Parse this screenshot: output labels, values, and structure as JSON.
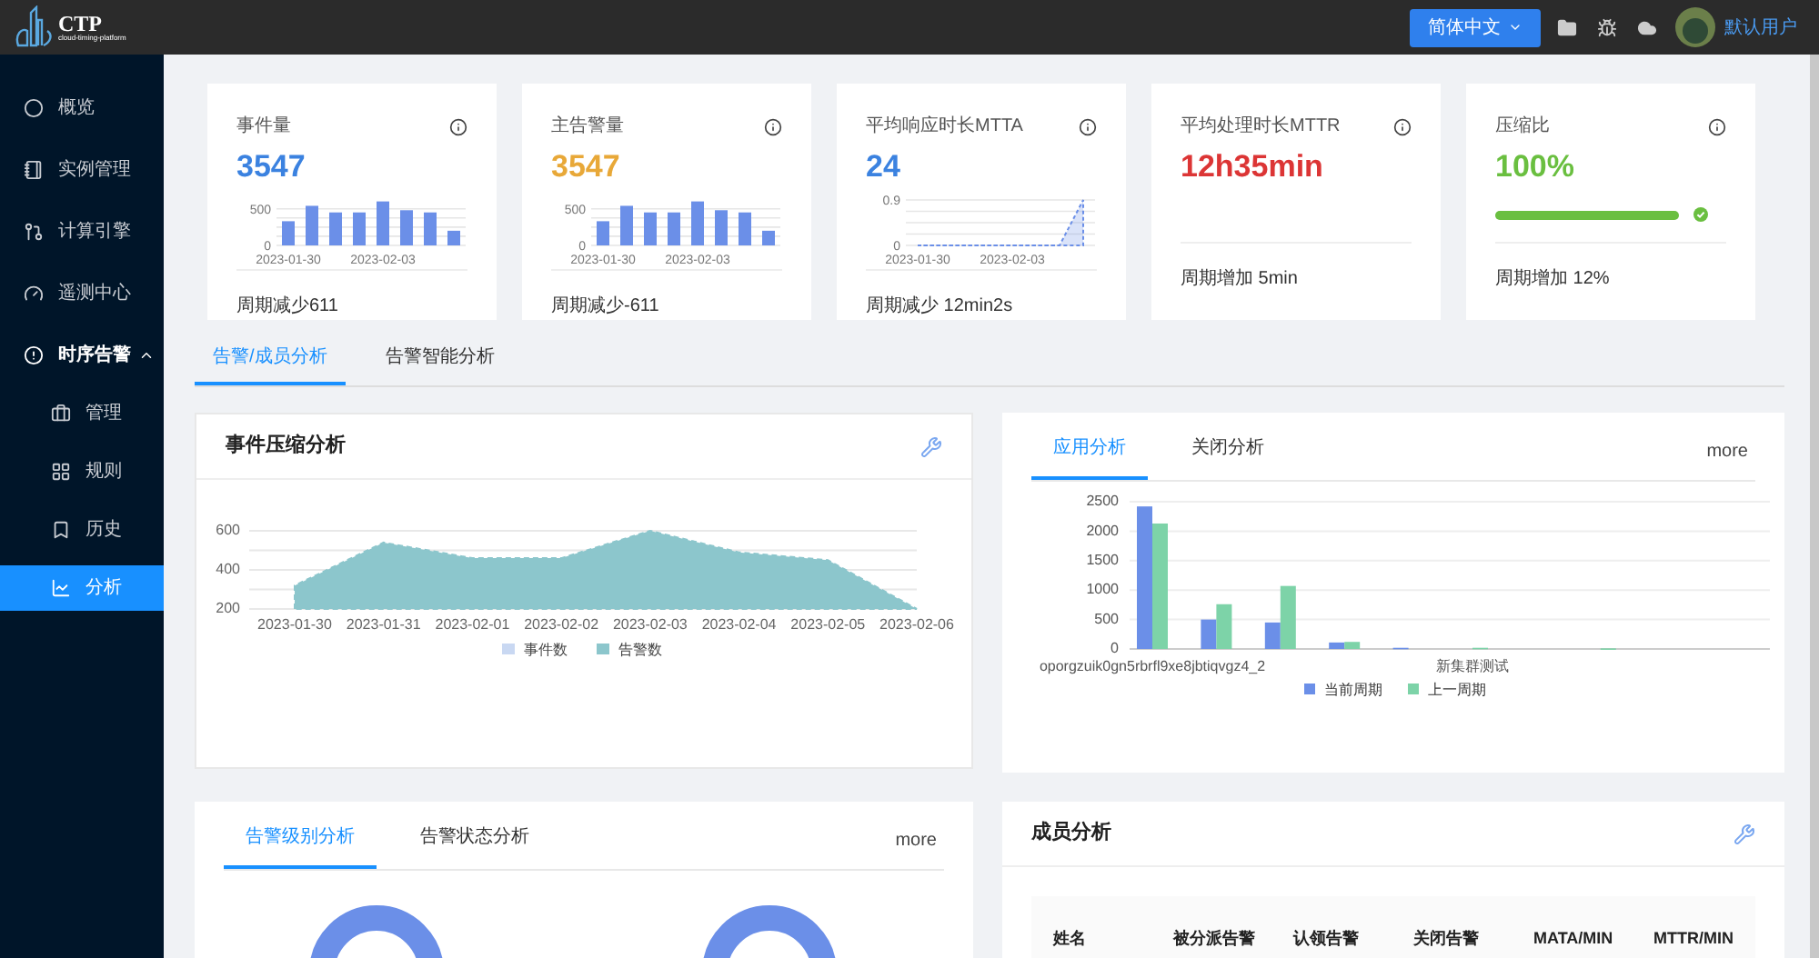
{
  "header": {
    "logo_title": "CTP",
    "logo_subtitle": "cloud-timing-platform",
    "language": "简体中文",
    "user": "默认用户"
  },
  "sidebar": {
    "items": [
      {
        "label": "概览",
        "selected": false
      },
      {
        "label": "实例管理",
        "selected": false
      },
      {
        "label": "计算引擎",
        "selected": false
      },
      {
        "label": "遥测中心",
        "selected": false
      },
      {
        "label": "时序告警",
        "selected": false,
        "expanded": true,
        "children": [
          {
            "label": "管理",
            "selected": false
          },
          {
            "label": "规则",
            "selected": false
          },
          {
            "label": "历史",
            "selected": false
          },
          {
            "label": "分析",
            "selected": true
          }
        ]
      }
    ]
  },
  "stat_cards": [
    {
      "kind": "bar",
      "title": "事件量",
      "value": "3547",
      "color": "#3b82e0",
      "footer": "周期减少611",
      "chart_data": {
        "type": "bar",
        "categories": [
          "2023-01-30",
          null,
          null,
          null,
          "2023-02-03",
          null,
          null,
          null
        ],
        "yticks": [
          0,
          500
        ],
        "ylim": [
          0,
          620
        ],
        "grid": true,
        "series": [
          {
            "color": "#6b8fe8",
            "values": [
              330,
              540,
              450,
              450,
              600,
              480,
              450,
              200
            ]
          }
        ]
      }
    },
    {
      "kind": "bar",
      "title": "主告警量",
      "value": "3547",
      "color": "#e8a838",
      "footer": "周期减少-611",
      "chart_data": {
        "type": "bar",
        "categories": [
          "2023-01-30",
          null,
          null,
          null,
          "2023-02-03",
          null,
          null,
          null
        ],
        "yticks": [
          0,
          500
        ],
        "ylim": [
          0,
          620
        ],
        "grid": true,
        "series": [
          {
            "color": "#6b8fe8",
            "values": [
              330,
              540,
              450,
              450,
              600,
              480,
              450,
              200
            ]
          }
        ]
      }
    },
    {
      "kind": "line",
      "title": "平均响应时长MTTA",
      "value": "24",
      "color": "#3b82e0",
      "footer": "周期减少 12min2s",
      "chart_data": {
        "type": "area",
        "categories": [
          "2023-01-30",
          null,
          null,
          null,
          "2023-02-03",
          null,
          null,
          null
        ],
        "yticks": [
          0,
          0.9
        ],
        "ylim": [
          0,
          0.9
        ],
        "grid": true,
        "series": [
          {
            "color": "#6b8fe8",
            "values": [
              0,
              0,
              0,
              0,
              0,
              0,
              0,
              0.9
            ]
          }
        ]
      }
    },
    {
      "kind": "none",
      "title": "平均处理时长MTTR",
      "value": "12h35min",
      "color": "#dc3535",
      "footer": "周期增加 5min"
    },
    {
      "kind": "progress",
      "title": "压缩比",
      "value": "100%",
      "color": "#6abf40",
      "level": 1,
      "footer": "周期增加 12%"
    }
  ],
  "tabs": [
    {
      "label": "告警/成员分析",
      "selected": true
    },
    {
      "label": "告警智能分析",
      "selected": false
    }
  ],
  "compression_panel": {
    "title": "事件压缩分析",
    "chart_data": {
      "type": "area",
      "categories": [
        "2023-01-30",
        "2023-01-31",
        "2023-02-01",
        "2023-02-02",
        "2023-02-03",
        "2023-02-04",
        "2023-02-05",
        "2023-02-06"
      ],
      "yticks": [
        200,
        400,
        600
      ],
      "ylim": [
        200,
        600
      ],
      "grid": true,
      "legend": "bottom",
      "series": [
        {
          "name": "事件数",
          "color": "#c9d8f2",
          "values": [
            null,
            null,
            null,
            null,
            null,
            null,
            null,
            null
          ]
        },
        {
          "name": "告警数",
          "color": "#8cc6cc",
          "values": [
            320,
            540,
            460,
            460,
            600,
            490,
            450,
            200
          ]
        }
      ]
    }
  },
  "app_panel": {
    "tabs": [
      {
        "label": "应用分析",
        "selected": true
      },
      {
        "label": "关闭分析",
        "selected": false
      }
    ],
    "more": "more",
    "chart_data": {
      "type": "bar",
      "categories": [
        "oporgzuik0gn5rbrfl9xe8jbtiqvgz4_2",
        null,
        null,
        null,
        null,
        "新集群测试",
        null,
        null,
        null,
        null
      ],
      "yticks": [
        0,
        500,
        1000,
        1500,
        2000,
        2500
      ],
      "ylim": [
        0,
        2500
      ],
      "grid": true,
      "legend": "bottom",
      "series": [
        {
          "name": "当前周期",
          "color": "#6b8fe8",
          "values": [
            2420,
            500,
            450,
            110,
            20,
            0,
            0,
            0,
            0,
            0
          ]
        },
        {
          "name": "上一周期",
          "color": "#7dd3a8",
          "values": [
            2130,
            760,
            1070,
            120,
            0,
            20,
            0,
            10,
            0,
            0
          ]
        }
      ]
    }
  },
  "level_panel": {
    "tabs": [
      {
        "label": "告警级别分析",
        "selected": true
      },
      {
        "label": "告警状态分析",
        "selected": false
      }
    ],
    "more": "more"
  },
  "member_panel": {
    "title": "成员分析",
    "columns": [
      "姓名",
      "被分派告警",
      "认领告警",
      "关闭告警",
      "MATA/MIN",
      "MTTR/MIN"
    ]
  }
}
